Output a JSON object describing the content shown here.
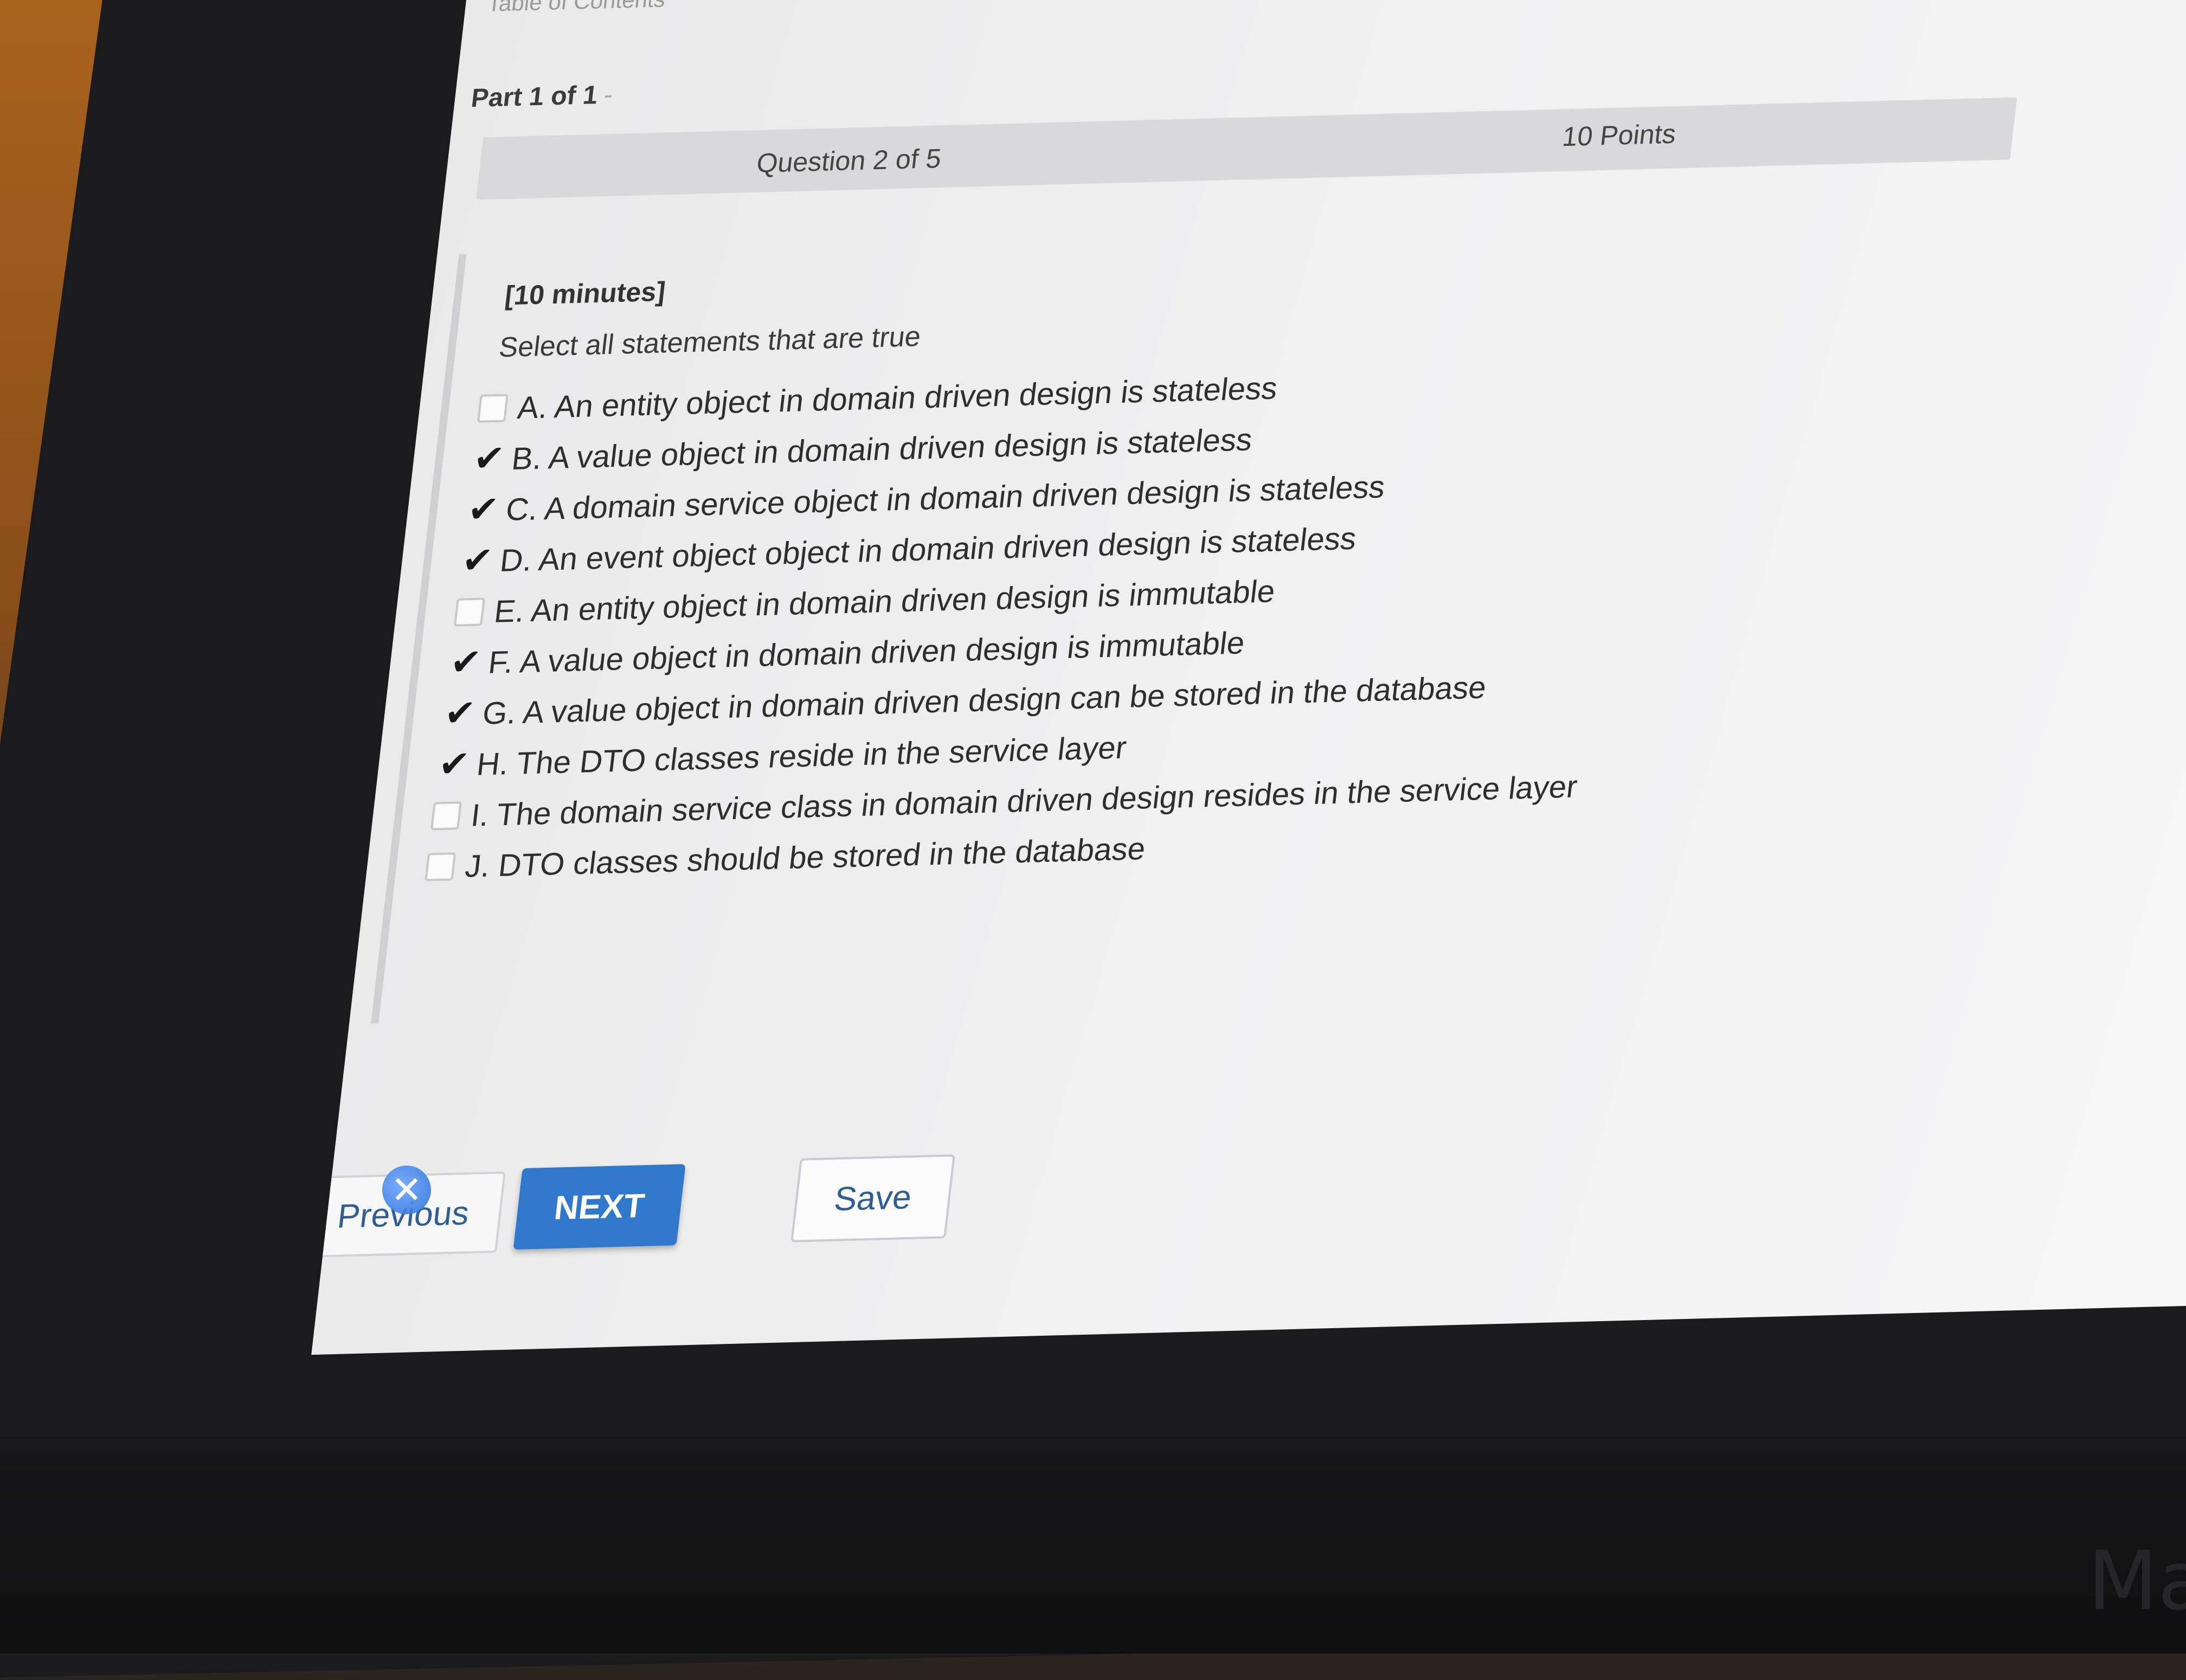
{
  "header": {
    "toc_label": "Table of Contents",
    "part_label": "Part 1 of 1",
    "part_separator": "-"
  },
  "question": {
    "number_label": "Question 2 of 5",
    "points_label": "10 Points",
    "time_label": "[10 minutes]",
    "instructions": "Select all statements that are true",
    "options": [
      {
        "label": "A. An entity object in domain driven design is stateless",
        "checked": false
      },
      {
        "label": "B. A value object in domain driven design is stateless",
        "checked": true
      },
      {
        "label": "C. A domain service object in domain driven design is stateless",
        "checked": true
      },
      {
        "label": "D. An event object object in domain driven design is stateless",
        "checked": true
      },
      {
        "label": "E. An entity object in domain driven design is immutable",
        "checked": false
      },
      {
        "label": "F. A value object in domain driven design is immutable",
        "checked": true
      },
      {
        "label": "G. A value object in domain driven design can be stored in the database",
        "checked": true
      },
      {
        "label": "H. The DTO classes reside in the service layer",
        "checked": true
      },
      {
        "label": "I. The domain service class in domain driven design resides in the service layer",
        "checked": false
      },
      {
        "label": "J. DTO classes should be stored in the database",
        "checked": false
      }
    ]
  },
  "buttons": {
    "previous_label": "Previous",
    "next_label": "NEXT",
    "save_label": "Save"
  },
  "icons": {
    "checkmark": "check-icon",
    "cursor": "mouse-cursor-icon",
    "overlay": "overlay-badge-icon"
  },
  "colors": {
    "next_button": "#2f78cc",
    "link_text": "#2f5d96",
    "question_bar": "#d9d9db"
  }
}
